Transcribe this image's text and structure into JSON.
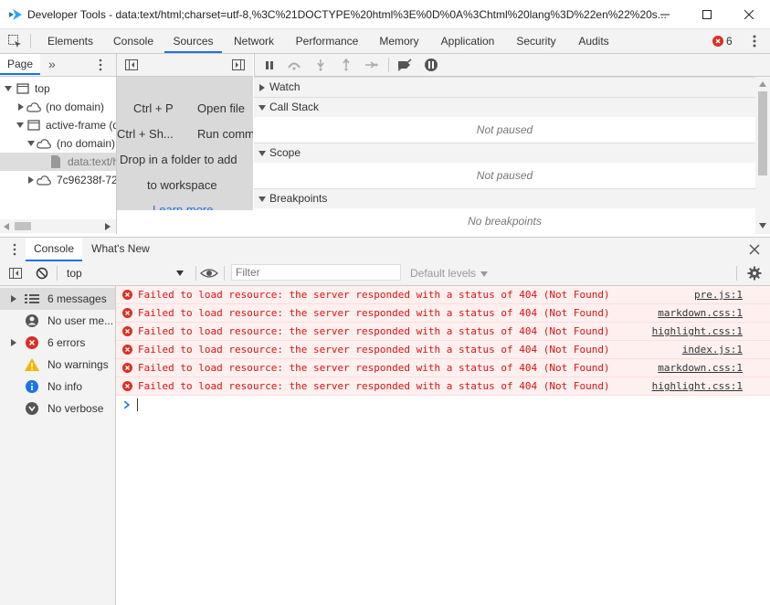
{
  "window": {
    "title": "Developer Tools - data:text/html;charset=utf-8,%3C%21DOCTYPE%20html%3E%0D%0A%3Chtml%20lang%3D%22en%22%20s..."
  },
  "main_tabs": [
    {
      "label": "Elements"
    },
    {
      "label": "Console"
    },
    {
      "label": "Sources"
    },
    {
      "label": "Network"
    },
    {
      "label": "Performance"
    },
    {
      "label": "Memory"
    },
    {
      "label": "Application"
    },
    {
      "label": "Security"
    },
    {
      "label": "Audits"
    }
  ],
  "active_tab": "Sources",
  "error_count": "6",
  "navigator": {
    "tab_label": "Page",
    "tree": [
      {
        "label": "top"
      },
      {
        "label": "(no domain)"
      },
      {
        "label": "active-frame (d"
      },
      {
        "label": "(no domain)"
      },
      {
        "label": "data:text/h"
      },
      {
        "label": "7c96238f-72"
      }
    ]
  },
  "editor": {
    "shortcuts": [
      {
        "keys": "Ctrl + P",
        "action": "Open file"
      },
      {
        "keys": "Ctrl + Sh...",
        "action": "Run comm"
      }
    ],
    "drop_line1": "Drop in a folder to add",
    "drop_line2": "to workspace",
    "learn_more": "Learn more"
  },
  "debugger": {
    "sections": [
      {
        "title": "Watch",
        "body": ""
      },
      {
        "title": "Call Stack",
        "body": "Not paused"
      },
      {
        "title": "Scope",
        "body": "Not paused"
      },
      {
        "title": "Breakpoints",
        "body": "No breakpoints"
      }
    ]
  },
  "drawer": {
    "tabs": [
      {
        "label": "Console"
      },
      {
        "label": "What's New"
      }
    ]
  },
  "console": {
    "context": "top",
    "filter_placeholder": "Filter",
    "levels_label": "Default levels",
    "sidebar": [
      {
        "label": "6 messages",
        "icon": "list-icon"
      },
      {
        "label": "No user me...",
        "icon": "user-icon"
      },
      {
        "label": "6 errors",
        "icon": "error-icon"
      },
      {
        "label": "No warnings",
        "icon": "warning-icon"
      },
      {
        "label": "No info",
        "icon": "info-icon"
      },
      {
        "label": "No verbose",
        "icon": "verbose-icon"
      }
    ],
    "messages": [
      {
        "text": "Failed to load resource: the server responded with a status of 404 (Not Found)",
        "source": "pre.js:1"
      },
      {
        "text": "Failed to load resource: the server responded with a status of 404 (Not Found)",
        "source": "markdown.css:1"
      },
      {
        "text": "Failed to load resource: the server responded with a status of 404 (Not Found)",
        "source": "highlight.css:1"
      },
      {
        "text": "Failed to load resource: the server responded with a status of 404 (Not Found)",
        "source": "index.js:1"
      },
      {
        "text": "Failed to load resource: the server responded with a status of 404 (Not Found)",
        "source": "markdown.css:1"
      },
      {
        "text": "Failed to load resource: the server responded with a status of 404 (Not Found)",
        "source": "highlight.css:1"
      }
    ]
  },
  "colors": {
    "accent": "#1a73e8",
    "error": "#d93025",
    "app_logo": "#23a9f2"
  }
}
